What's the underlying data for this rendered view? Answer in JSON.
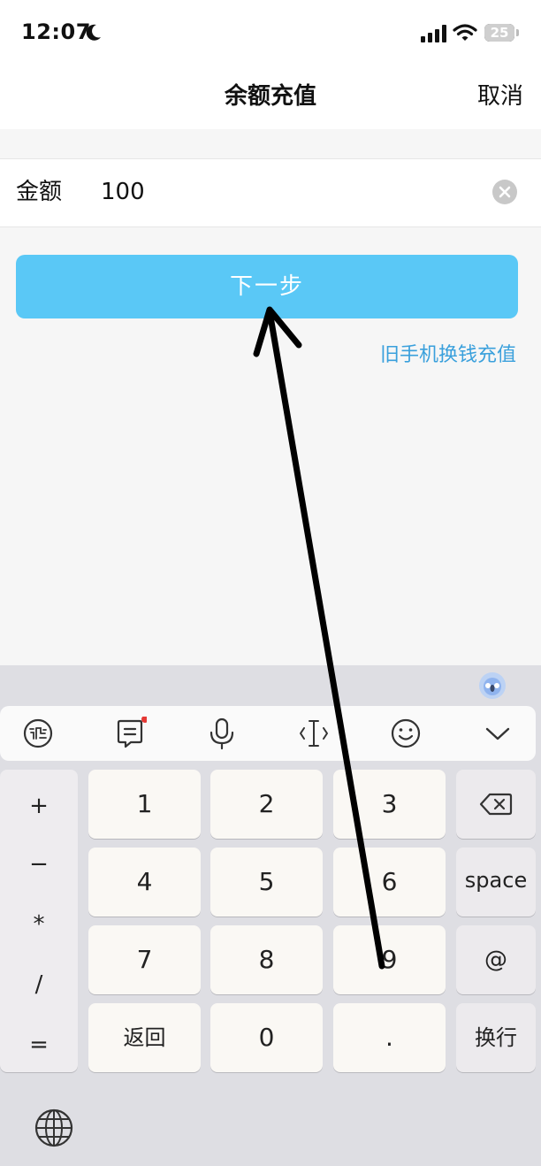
{
  "status_bar": {
    "time": "12:07",
    "battery": "25"
  },
  "nav": {
    "title": "余额充值",
    "cancel": "取消"
  },
  "amount": {
    "label": "金额",
    "value": "100"
  },
  "actions": {
    "next": "下一步",
    "old_phone_link": "旧手机换钱充值"
  },
  "keyboard": {
    "symbols": [
      "+",
      "−",
      "*",
      "/",
      "="
    ],
    "keys": {
      "k1": "1",
      "k2": "2",
      "k3": "3",
      "k4": "4",
      "k5": "5",
      "k6": "6",
      "k7": "7",
      "k8": "8",
      "k9": "9",
      "back": "返回",
      "k0": "0",
      "dot": ".",
      "space": "space",
      "at": "@",
      "newline": "换行"
    }
  },
  "colors": {
    "accent": "#5ac8f6",
    "link": "#3aa0dc",
    "notification_dot": "#e53935"
  }
}
